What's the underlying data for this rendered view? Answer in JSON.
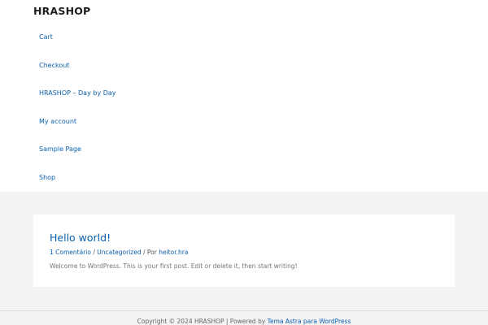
{
  "site": {
    "title": "HRASHOP"
  },
  "nav": {
    "items": [
      "Cart",
      "Checkout",
      "HRASHOP – Day by Day",
      "My account",
      "Sample Page",
      "Shop"
    ]
  },
  "post": {
    "title": "Hello world!",
    "comments": "1 Comentário",
    "separator": " / ",
    "category": "Uncategorized",
    "by_prefix": " / Por ",
    "author": "heitor.hra",
    "excerpt": "Welcome to WordPress. This is your first post. Edit or delete it, then start writing!"
  },
  "footer": {
    "copyright": "Copyright © 2024 HRASHOP | Powered by ",
    "theme_link": "Tema Astra para WordPress"
  },
  "colors": {
    "link": "#0b5fae",
    "background_band": "#f3f3f3"
  }
}
